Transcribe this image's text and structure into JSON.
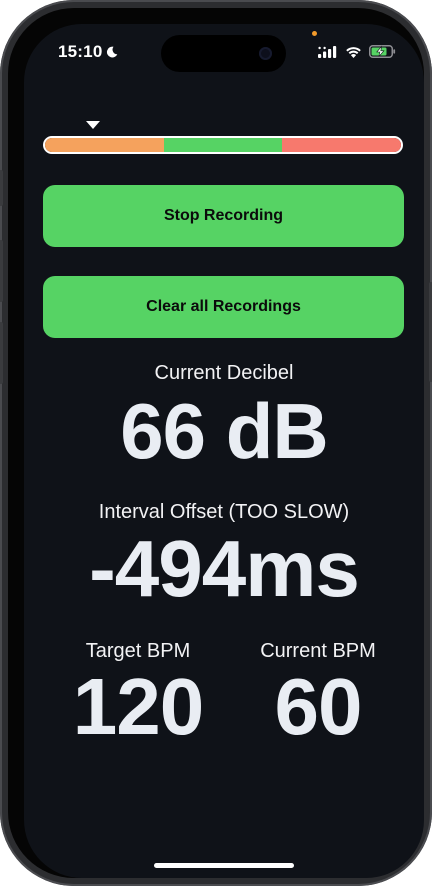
{
  "status_bar": {
    "time": "15:10",
    "icons": [
      "moon-icon",
      "cellular-icon",
      "wifi-icon",
      "battery-charging-icon"
    ]
  },
  "level_meter": {
    "segments": [
      {
        "name": "low",
        "color": "#f5a25d"
      },
      {
        "name": "ok",
        "color": "#56d364"
      },
      {
        "name": "high",
        "color": "#f7796d"
      }
    ],
    "marker_fraction": 0.14
  },
  "buttons": {
    "stop_recording": "Stop Recording",
    "clear_recordings": "Clear all Recordings"
  },
  "decibel": {
    "label": "Current Decibel",
    "value": "66 dB"
  },
  "interval": {
    "label": "Interval Offset (TOO SLOW)",
    "value": "-494ms"
  },
  "bpm": {
    "target_label": "Target BPM",
    "target_value": "120",
    "current_label": "Current BPM",
    "current_value": "60"
  },
  "colors": {
    "background": "#0f1218",
    "accent_green": "#56d364",
    "text": "#e9edf3"
  }
}
